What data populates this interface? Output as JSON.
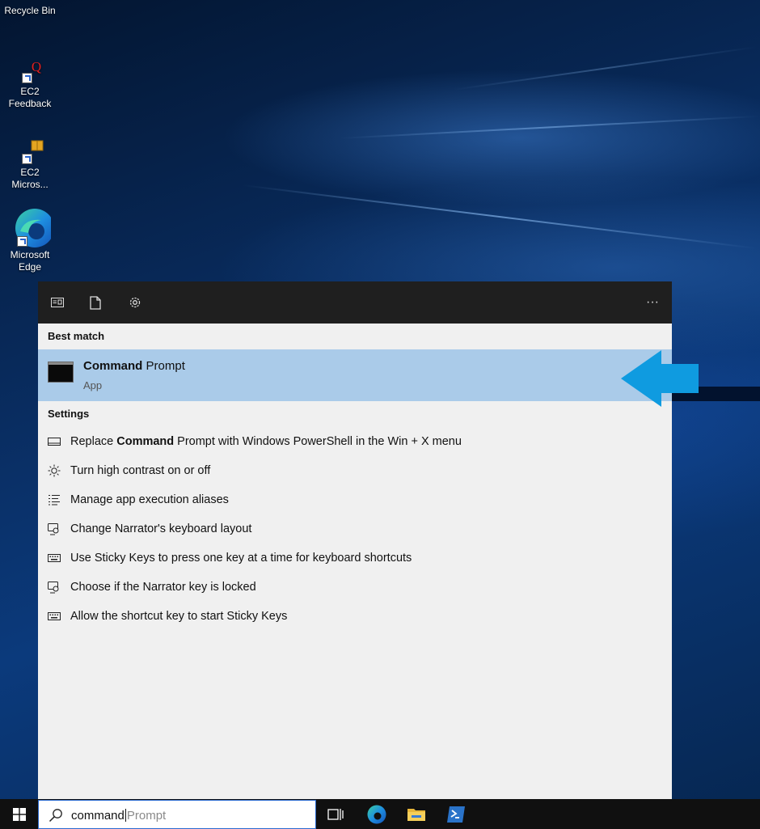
{
  "desktop": {
    "icons": [
      {
        "label": "Recycle Bin"
      },
      {
        "label": "EC2\nFeedback"
      },
      {
        "label": "EC2\nMicros..."
      },
      {
        "label": "Microsoft\nEdge"
      }
    ]
  },
  "search_panel": {
    "best_match_label": "Best match",
    "best_match": {
      "title_bold": "Command",
      "title_rest": " Prompt",
      "subtitle": "App"
    },
    "settings_label": "Settings",
    "settings": [
      {
        "icon": "taskbar-icon",
        "pre": "Replace ",
        "bold": "Command",
        "post": " Prompt with Windows PowerShell in the Win + X menu"
      },
      {
        "icon": "brightness-icon",
        "pre": "Turn high contrast on or off",
        "bold": "",
        "post": ""
      },
      {
        "icon": "list-icon",
        "pre": "Manage app execution aliases",
        "bold": "",
        "post": ""
      },
      {
        "icon": "narrator-icon",
        "pre": "Change Narrator's keyboard layout",
        "bold": "",
        "post": ""
      },
      {
        "icon": "keyboard-icon",
        "pre": "Use Sticky Keys to press one key at a time for keyboard shortcuts",
        "bold": "",
        "post": ""
      },
      {
        "icon": "narrator-icon",
        "pre": "Choose if the Narrator key is locked",
        "bold": "",
        "post": ""
      },
      {
        "icon": "keyboard-icon",
        "pre": "Allow the shortcut key to start Sticky Keys",
        "bold": "",
        "post": ""
      }
    ],
    "more_label": "···"
  },
  "taskbar": {
    "search_typed": "command",
    "search_hint": "Prompt"
  },
  "colors": {
    "highlight": "#aacbe9",
    "arrow": "#0f9be0",
    "panel_header": "#1f1f1f"
  }
}
